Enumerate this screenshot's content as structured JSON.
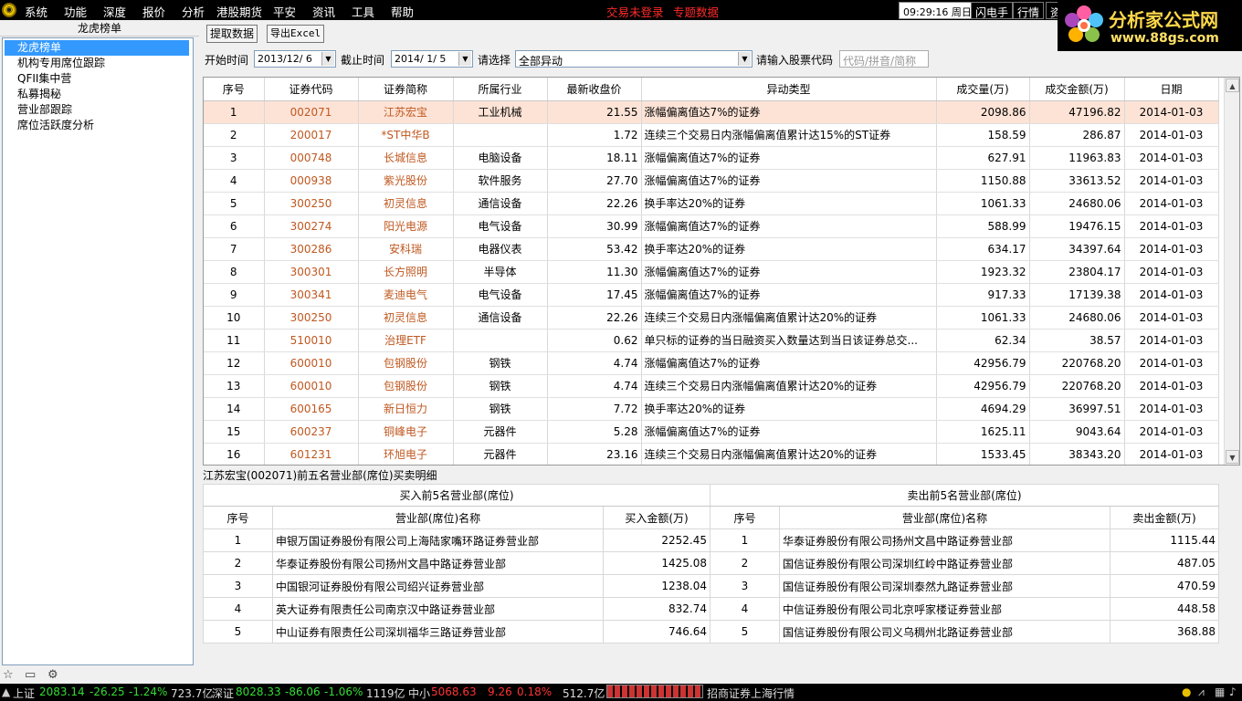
{
  "menubar": {
    "items": [
      "系统",
      "功能",
      "深度",
      "报价",
      "分析",
      "港股期货",
      "平安",
      "资讯",
      "工具",
      "帮助"
    ],
    "warnings": [
      "交易未登录",
      "专题数据"
    ],
    "time": "09:29:16",
    "weekday": "周日",
    "buttons": [
      "闪电手",
      "行情",
      "资"
    ]
  },
  "brand": {
    "line1": "分析家公式网",
    "line2": "www.88gs.com"
  },
  "left_panel": {
    "title": "龙虎榜单",
    "items": [
      "龙虎榜单",
      "机构专用席位跟踪",
      "QFII集中营",
      "私募揭秘",
      "营业部跟踪",
      "席位活跃度分析"
    ]
  },
  "toolbar": {
    "fetch": "提取数据",
    "export": "导出Excel"
  },
  "filters": {
    "start_label": "开始时间",
    "start_value": "2013/12/ 6",
    "end_label": "截止时间",
    "end_value": "2014/ 1/ 5",
    "select_label": "请选择",
    "select_value": "全部异动",
    "code_label": "请输入股票代码",
    "code_placeholder": "代码/拼音/简称"
  },
  "main_table": {
    "columns": [
      "序号",
      "证券代码",
      "证券简称",
      "所属行业",
      "最新收盘价",
      "异动类型",
      "成交量(万)",
      "成交金额(万)",
      "日期"
    ],
    "rows": [
      [
        "1",
        "002071",
        "江苏宏宝",
        "工业机械",
        "21.55",
        "涨幅偏离值达7%的证券",
        "2098.86",
        "47196.82",
        "2014-01-03"
      ],
      [
        "2",
        "200017",
        "*ST中华B",
        "",
        "1.72",
        "连续三个交易日内涨幅偏离值累计达15%的ST证券",
        "158.59",
        "286.87",
        "2014-01-03"
      ],
      [
        "3",
        "000748",
        "长城信息",
        "电脑设备",
        "18.11",
        "涨幅偏离值达7%的证券",
        "627.91",
        "11963.83",
        "2014-01-03"
      ],
      [
        "4",
        "000938",
        "紫光股份",
        "软件服务",
        "27.70",
        "涨幅偏离值达7%的证券",
        "1150.88",
        "33613.52",
        "2014-01-03"
      ],
      [
        "5",
        "300250",
        "初灵信息",
        "通信设备",
        "22.26",
        "换手率达20%的证券",
        "1061.33",
        "24680.06",
        "2014-01-03"
      ],
      [
        "6",
        "300274",
        "阳光电源",
        "电气设备",
        "30.99",
        "涨幅偏离值达7%的证券",
        "588.99",
        "19476.15",
        "2014-01-03"
      ],
      [
        "7",
        "300286",
        "安科瑞",
        "电器仪表",
        "53.42",
        "换手率达20%的证券",
        "634.17",
        "34397.64",
        "2014-01-03"
      ],
      [
        "8",
        "300301",
        "长方照明",
        "半导体",
        "11.30",
        "涨幅偏离值达7%的证券",
        "1923.32",
        "23804.17",
        "2014-01-03"
      ],
      [
        "9",
        "300341",
        "麦迪电气",
        "电气设备",
        "17.45",
        "涨幅偏离值达7%的证券",
        "917.33",
        "17139.38",
        "2014-01-03"
      ],
      [
        "10",
        "300250",
        "初灵信息",
        "通信设备",
        "22.26",
        "连续三个交易日内涨幅偏离值累计达20%的证券",
        "1061.33",
        "24680.06",
        "2014-01-03"
      ],
      [
        "11",
        "510010",
        "治理ETF",
        "",
        "0.62",
        "单只标的证券的当日融资买入数量达到当日该证券总交...",
        "62.34",
        "38.57",
        "2014-01-03"
      ],
      [
        "12",
        "600010",
        "包钢股份",
        "钢铁",
        "4.74",
        "涨幅偏离值达7%的证券",
        "42956.79",
        "220768.20",
        "2014-01-03"
      ],
      [
        "13",
        "600010",
        "包钢股份",
        "钢铁",
        "4.74",
        "连续三个交易日内涨幅偏离值累计达20%的证券",
        "42956.79",
        "220768.20",
        "2014-01-03"
      ],
      [
        "14",
        "600165",
        "新日恒力",
        "钢铁",
        "7.72",
        "换手率达20%的证券",
        "4694.29",
        "36997.51",
        "2014-01-03"
      ],
      [
        "15",
        "600237",
        "铜峰电子",
        "元器件",
        "5.28",
        "涨幅偏离值达7%的证券",
        "1625.11",
        "9043.64",
        "2014-01-03"
      ],
      [
        "16",
        "601231",
        "环旭电子",
        "元器件",
        "23.16",
        "连续三个交易日内涨幅偏离值累计达20%的证券",
        "1533.45",
        "38343.20",
        "2014-01-03"
      ]
    ]
  },
  "detail": {
    "title": "江苏宏宝(002071)前五名营业部(席位)买卖明细",
    "buy_group": "买入前5名营业部(席位)",
    "sell_group": "卖出前5名营业部(席位)",
    "buy_columns": [
      "序号",
      "营业部(席位)名称",
      "买入金额(万)"
    ],
    "sell_columns": [
      "序号",
      "营业部(席位)名称",
      "卖出金额(万)"
    ],
    "buy_rows": [
      [
        "1",
        "申银万国证券股份有限公司上海陆家嘴环路证券营业部",
        "2252.45"
      ],
      [
        "2",
        "华泰证券股份有限公司扬州文昌中路证券营业部",
        "1425.08"
      ],
      [
        "3",
        "中国银河证券股份有限公司绍兴证券营业部",
        "1238.04"
      ],
      [
        "4",
        "英大证券有限责任公司南京汉中路证券营业部",
        "832.74"
      ],
      [
        "5",
        "中山证券有限责任公司深圳福华三路证券营业部",
        "746.64"
      ]
    ],
    "sell_rows": [
      [
        "1",
        "华泰证券股份有限公司扬州文昌中路证券营业部",
        "1115.44"
      ],
      [
        "2",
        "国信证券股份有限公司深圳红岭中路证券营业部",
        "487.05"
      ],
      [
        "3",
        "国信证券股份有限公司深圳泰然九路证券营业部",
        "470.59"
      ],
      [
        "4",
        "中信证券股份有限公司北京呼家楼证券营业部",
        "448.58"
      ],
      [
        "5",
        "国信证券股份有限公司义乌稠州北路证券营业部",
        "368.88"
      ]
    ]
  },
  "statusbar": {
    "sh_label": "上证",
    "sh_index": "2083.14",
    "sh_change": "-26.25",
    "sh_pct": "-1.24%",
    "sh_amount": "723.7亿",
    "sz_label": "深证",
    "sz_index": "8028.33",
    "sz_change": "-86.06",
    "sz_pct": "-1.06%",
    "sz_amount": "1119亿",
    "zx_label": "中小",
    "zx_index": "5068.63",
    "zx_change": "9.26",
    "zx_pct": "0.18%",
    "zx_amount": "512.7亿",
    "broker": "招商证券上海行情"
  },
  "colors": {
    "up": "#ff3333",
    "down": "#33dd33",
    "code": "#c05820",
    "selected_row": "#fde3d6",
    "selected_item": "#3399ff"
  }
}
